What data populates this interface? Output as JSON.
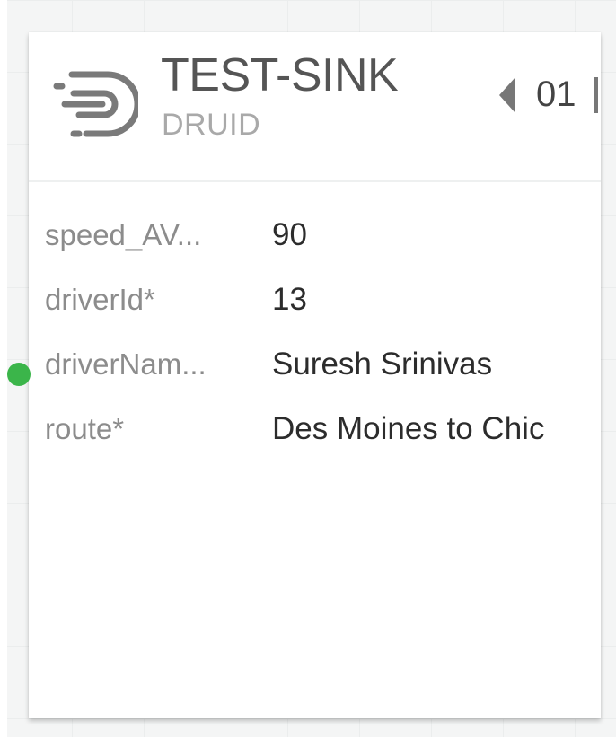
{
  "node": {
    "title": "TEST-SINK",
    "subtitle": "DRUID",
    "parallelism": "01",
    "icon": "sink-icon"
  },
  "fields": [
    {
      "name": "speed_AV...",
      "value": "90"
    },
    {
      "name": "driverId*",
      "value": "13"
    },
    {
      "name": "driverNam...",
      "value": "Suresh Srinivas"
    },
    {
      "name": "route*",
      "value": "Des Moines to Chic"
    }
  ],
  "colors": {
    "port": "#3bb54a",
    "title": "#555555",
    "subtitle": "#a9a9a9"
  }
}
